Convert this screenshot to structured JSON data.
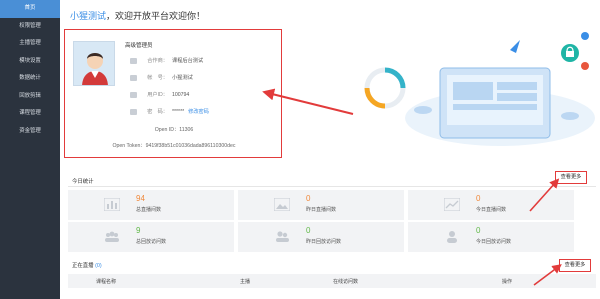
{
  "sidebar": {
    "items": [
      {
        "label": "首页",
        "active": true
      },
      {
        "label": "权限管理"
      },
      {
        "label": "主播管理"
      },
      {
        "label": "模块设置"
      },
      {
        "label": "数据统计"
      },
      {
        "label": "回放剪辑"
      },
      {
        "label": "课程管理"
      },
      {
        "label": "资金管理"
      }
    ]
  },
  "header": {
    "username": "小猩测试",
    "welcome_text": "，欢迎开放平台欢迎你！"
  },
  "profile": {
    "title": "高级管理员",
    "rows": [
      {
        "icon": "company-icon",
        "label": "合作商：",
        "value": "课程后台测试"
      },
      {
        "icon": "user-icon",
        "label": "帐　号：",
        "value": "小猩测试"
      },
      {
        "icon": "id-icon",
        "label": "用户ID：",
        "value": "100794"
      },
      {
        "icon": "lock-icon",
        "label": "密　码：",
        "value": "******",
        "link": "修改密码"
      }
    ],
    "open_id": "Open ID：11306",
    "open_token": "Open Token：9419f38b51c01036dada896110300dec"
  },
  "today_stats": {
    "title": "今日统计",
    "more_label": "查看更多",
    "cards": [
      {
        "value": "94",
        "label": "总直播间数",
        "color": "#f0893c",
        "icon": "bar-chart-icon"
      },
      {
        "value": "0",
        "label": "昨日直播间数",
        "color": "#f0893c",
        "icon": "image-icon"
      },
      {
        "value": "0",
        "label": "今日直播间数",
        "color": "#f0893c",
        "icon": "line-chart-icon"
      },
      {
        "value": "9",
        "label": "总回放访问数",
        "color": "#63b94b",
        "icon": "people-icon"
      },
      {
        "value": "0",
        "label": "昨日回放访问数",
        "color": "#63b94b",
        "icon": "users-icon"
      },
      {
        "value": "0",
        "label": "今日回放访问数",
        "color": "#63b94b",
        "icon": "person-icon"
      }
    ]
  },
  "live": {
    "title": "正在直播",
    "count": "(0)",
    "more_label": "查看更多",
    "columns": [
      "课程名称",
      "主播",
      "在线访问数",
      "操作"
    ]
  },
  "colors": {
    "sidebar_bg": "#2b333e",
    "active": "#4a8fd6",
    "annotation_red": "#e23b3b",
    "orange": "#f0893c",
    "green": "#63b94b"
  }
}
